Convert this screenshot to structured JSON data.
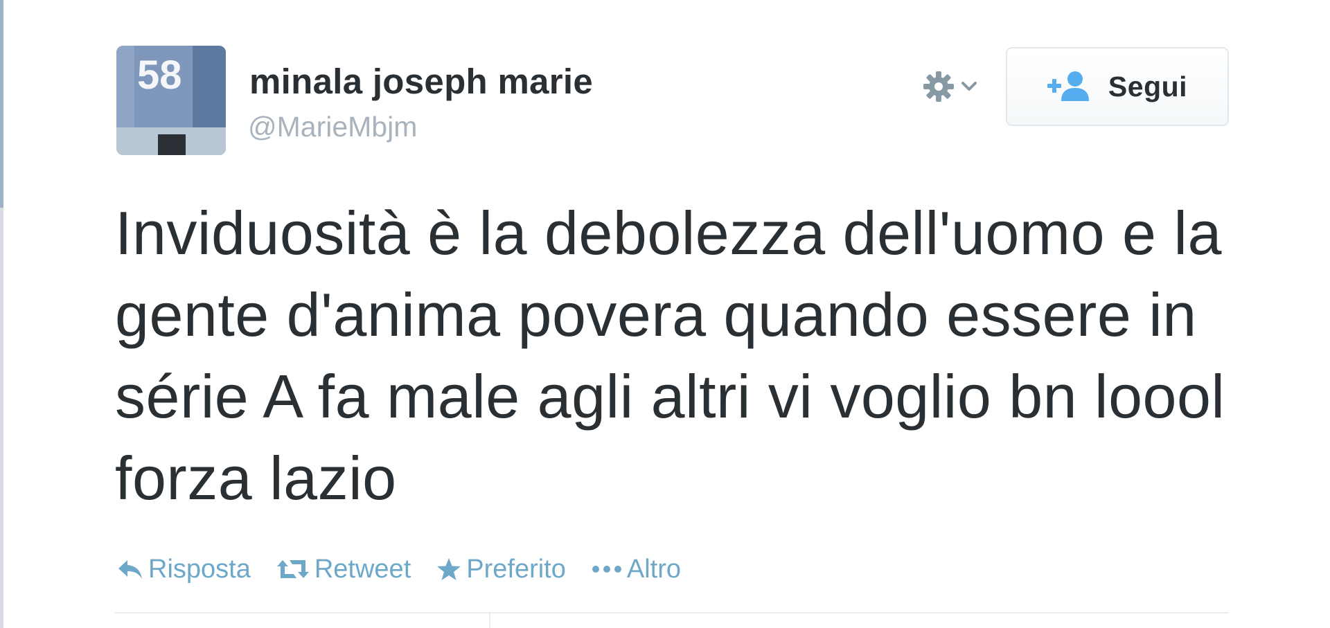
{
  "tweet": {
    "author": {
      "name": "minala joseph marie",
      "handle": "@MarieMbjm",
      "avatar_number": "58"
    },
    "follow_label": "Segui",
    "text": "Inviduosità è la debolezza dell'uomo e la gente d'anima povera quando essere in série A fa male agli altri vi voglio bn loool  forza lazio",
    "actions": [
      {
        "label": "Risposta",
        "icon": "reply-icon"
      },
      {
        "label": "Retweet",
        "icon": "retweet-icon"
      },
      {
        "label": "Preferito",
        "icon": "star-icon"
      },
      {
        "label": "Altro",
        "icon": "more-dots-icon"
      }
    ]
  },
  "colors": {
    "text": "#292f33",
    "handle": "#a8b3bd",
    "action": "#6ea8c8",
    "follow_icon": "#55acee",
    "gear": "#8899a6"
  }
}
